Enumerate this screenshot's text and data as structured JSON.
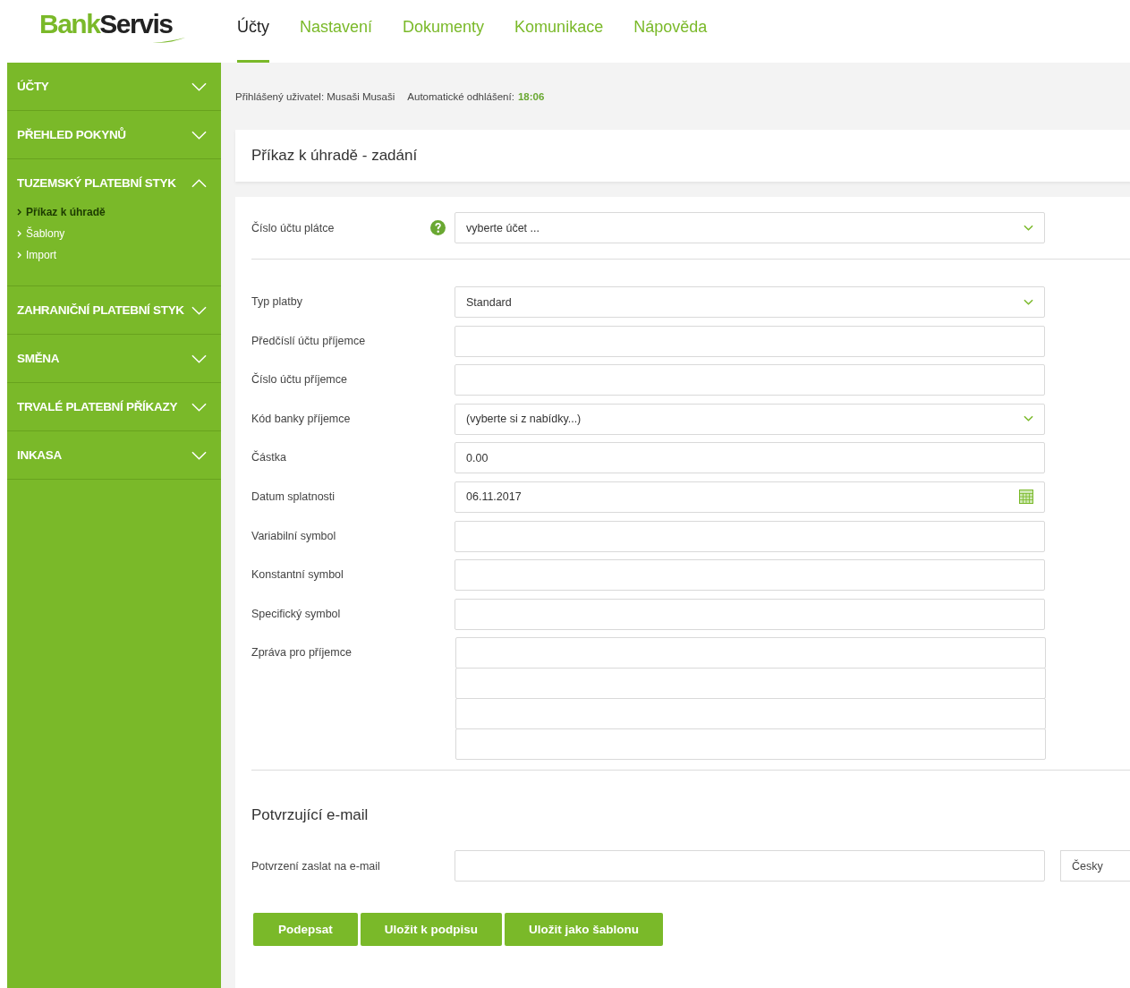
{
  "logo": {
    "first": "Bank",
    "second": "Servis"
  },
  "tabs": [
    {
      "label": "Účty",
      "selected": true
    },
    {
      "label": "Nastavení",
      "selected": false
    },
    {
      "label": "Dokumenty",
      "selected": false
    },
    {
      "label": "Komunikace",
      "selected": false
    },
    {
      "label": "Nápověda",
      "selected": false
    }
  ],
  "sidebar": {
    "items": [
      {
        "label": "ÚČTY",
        "expanded": false
      },
      {
        "label": "PŘEHLED POKYNŮ",
        "expanded": false
      },
      {
        "label": "TUZEMSKÝ PLATEBNÍ STYK",
        "expanded": true,
        "children": [
          {
            "label": "Příkaz k úhradě",
            "selected": true
          },
          {
            "label": "Šablony",
            "selected": false
          },
          {
            "label": "Import",
            "selected": false
          }
        ]
      },
      {
        "label": "ZAHRANIČNÍ PLATEBNÍ STYK",
        "expanded": false
      },
      {
        "label": "SMĚNA",
        "expanded": false
      },
      {
        "label": "TRVALÉ PLATEBNÍ PŘÍKAZY",
        "expanded": false
      },
      {
        "label": "INKASA",
        "expanded": false
      }
    ]
  },
  "user_bar": {
    "user": "Přihlášený uživatel: Musaši Musaši",
    "logout_label": "Automatické odhlášení:",
    "logout_time": "18:06"
  },
  "form": {
    "title": "Příkaz k úhradě - zadání",
    "payer": {
      "label": "Číslo účtu plátce",
      "kind": "select",
      "value": "vyberte účet ...",
      "help": true
    },
    "fields": [
      {
        "label": "Typ platby",
        "kind": "select",
        "value": "Standard"
      },
      {
        "label": "Předčíslí účtu příjemce",
        "kind": "text"
      },
      {
        "label": "Číslo účtu příjemce",
        "kind": "text"
      },
      {
        "label": "Kód banky příjemce",
        "kind": "select",
        "value": "(vyberte si z nabídky...)"
      },
      {
        "label": "Částka",
        "kind": "text",
        "value": "0.00"
      },
      {
        "label": "Datum splatnosti",
        "kind": "date",
        "value": "06.11.2017"
      },
      {
        "label": "Variabilní symbol",
        "kind": "text"
      },
      {
        "label": "Konstantní symbol",
        "kind": "text"
      },
      {
        "label": "Specifický symbol",
        "kind": "text"
      },
      {
        "label": "Zpráva pro příjemce",
        "kind": "message"
      }
    ],
    "email": {
      "title": "Potvrzující e-mail",
      "label": "Potvrzení zaslat na e-mail",
      "language": "Česky"
    },
    "buttons": [
      "Podepsat",
      "Uložit k podpisu",
      "Uložit jako šablonu"
    ]
  }
}
